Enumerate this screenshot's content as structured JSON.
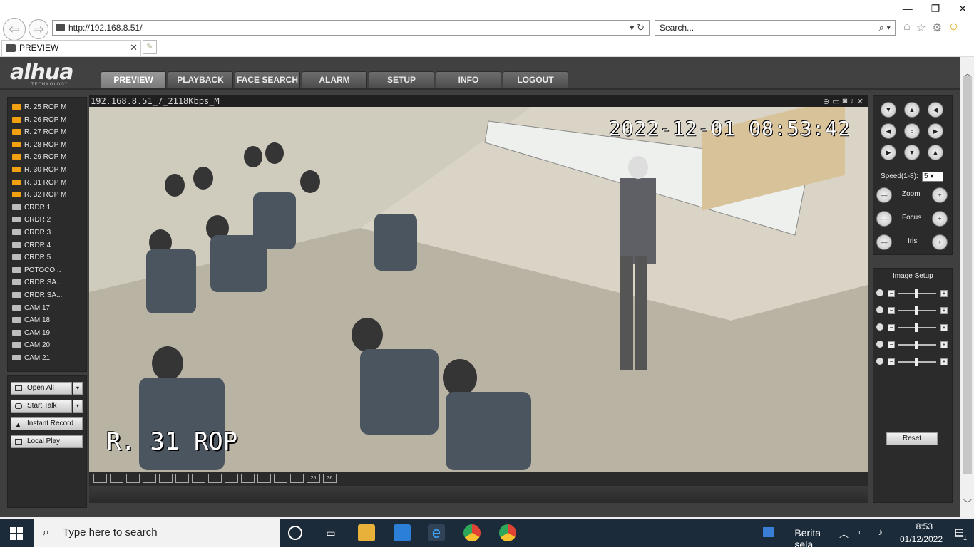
{
  "browser": {
    "url": "http://192.168.8.51/",
    "search_placeholder": "Search...",
    "tab_title": "PREVIEW"
  },
  "app": {
    "logo": "alhua",
    "logo_sub": "TECHNOLOGY",
    "menu": [
      "PREVIEW",
      "PLAYBACK",
      "FACE SEARCH",
      "ALARM",
      "SETUP",
      "INFO",
      "LOGOUT"
    ],
    "channels": [
      {
        "label": "R. 25 ROP   M",
        "status": "on"
      },
      {
        "label": "R. 26 ROP   M",
        "status": "on"
      },
      {
        "label": "R. 27 ROP   M",
        "status": "on"
      },
      {
        "label": "R. 28 ROP   M",
        "status": "on"
      },
      {
        "label": "R. 29 ROP   M",
        "status": "on"
      },
      {
        "label": "R. 30 ROP   M",
        "status": "on"
      },
      {
        "label": "R. 31 ROP   M",
        "status": "on"
      },
      {
        "label": "R. 32 ROP   M",
        "status": "on"
      },
      {
        "label": "CRDR 1",
        "status": "off"
      },
      {
        "label": "CRDR 2",
        "status": "off"
      },
      {
        "label": "CRDR 3",
        "status": "off"
      },
      {
        "label": "CRDR 4",
        "status": "off"
      },
      {
        "label": "CRDR 5",
        "status": "off"
      },
      {
        "label": "POTOCO...",
        "status": "off"
      },
      {
        "label": "CRDR SA...",
        "status": "off"
      },
      {
        "label": "CRDR SA...",
        "status": "off"
      },
      {
        "label": "CAM 17",
        "status": "off"
      },
      {
        "label": "CAM 18",
        "status": "off"
      },
      {
        "label": "CAM 19",
        "status": "off"
      },
      {
        "label": "CAM 20",
        "status": "off"
      },
      {
        "label": "CAM 21",
        "status": "off"
      }
    ],
    "actions": {
      "open_all": "Open All",
      "start_talk": "Start Talk",
      "instant_record": "Instant Record",
      "local_play": "Local Play"
    },
    "video": {
      "title": "192.168.8.51_7_2118Kbps_M",
      "osd_time": "2022-12-01  08:53:42",
      "osd_name": "R. 31 ROP"
    },
    "layouts": [
      "",
      "",
      "",
      "",
      "",
      "",
      "",
      "",
      "",
      "",
      "",
      "",
      "",
      "25",
      "36"
    ],
    "ptz": {
      "speed_label": "Speed(1-8):",
      "speed_value": "5",
      "zoom": "Zoom",
      "focus": "Focus",
      "iris": "Iris"
    },
    "image_setup": {
      "title": "Image Setup",
      "reset": "Reset"
    }
  },
  "taskbar": {
    "search": "Type here to search",
    "news": "Berita sela",
    "time": "8:53",
    "date": "01/12/2022",
    "notif_count": "1"
  }
}
